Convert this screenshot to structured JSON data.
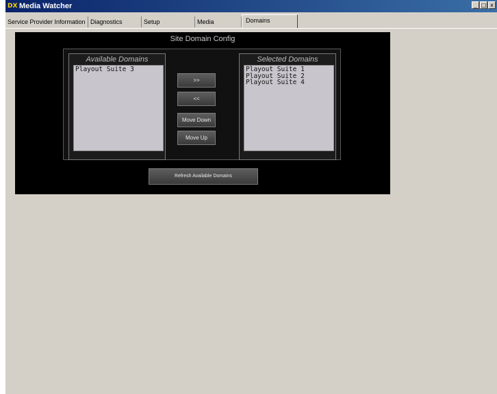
{
  "window": {
    "app_icon": "DX",
    "title": "Media Watcher",
    "buttons": {
      "minimize": "_",
      "maximize": "□",
      "close": "x"
    }
  },
  "tabs": [
    {
      "label": "Service Provider Information"
    },
    {
      "label": "Diagnostics"
    },
    {
      "label": "Setup"
    },
    {
      "label": "Media"
    },
    {
      "label": "Domains"
    }
  ],
  "panel": {
    "title": "Site Domain Config",
    "available": {
      "title": "Available Domains",
      "items": [
        "Playout Suite 3"
      ]
    },
    "selected": {
      "title": "Selected Domains",
      "items": [
        "Playout Suite 1",
        "Playout Suite 2",
        "Playout Suite 4"
      ]
    },
    "buttons": {
      "add": ">>",
      "remove": "<<",
      "move_down": "Move Down",
      "move_up": "Move Up",
      "refresh": "Refresh Available Domains"
    }
  }
}
